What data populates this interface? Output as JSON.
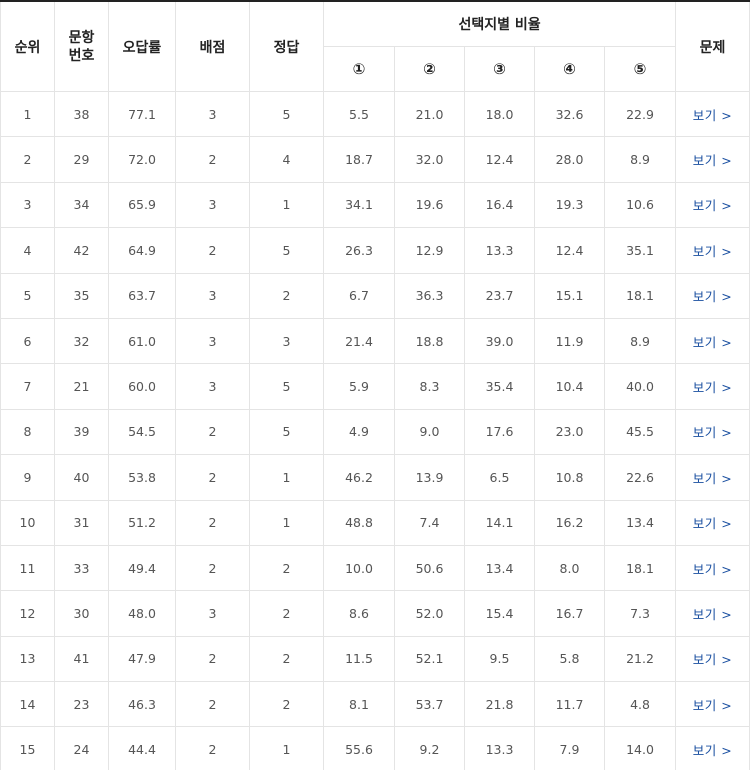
{
  "table": {
    "headers": {
      "rank": "순위",
      "question_no_line1": "문항",
      "question_no_line2": "번호",
      "error_rate": "오답률",
      "points": "배점",
      "answer": "정답",
      "choice_ratio": "선택지별 비율",
      "problem": "문제",
      "choices": [
        "①",
        "②",
        "③",
        "④",
        "⑤"
      ]
    },
    "view_label": "보기 >",
    "rows": [
      {
        "rank": "1",
        "no": "38",
        "rate": "77.1",
        "points": "3",
        "answer": "5",
        "c1": "5.5",
        "c2": "21.0",
        "c3": "18.0",
        "c4": "32.6",
        "c5": "22.9"
      },
      {
        "rank": "2",
        "no": "29",
        "rate": "72.0",
        "points": "2",
        "answer": "4",
        "c1": "18.7",
        "c2": "32.0",
        "c3": "12.4",
        "c4": "28.0",
        "c5": "8.9"
      },
      {
        "rank": "3",
        "no": "34",
        "rate": "65.9",
        "points": "3",
        "answer": "1",
        "c1": "34.1",
        "c2": "19.6",
        "c3": "16.4",
        "c4": "19.3",
        "c5": "10.6"
      },
      {
        "rank": "4",
        "no": "42",
        "rate": "64.9",
        "points": "2",
        "answer": "5",
        "c1": "26.3",
        "c2": "12.9",
        "c3": "13.3",
        "c4": "12.4",
        "c5": "35.1"
      },
      {
        "rank": "5",
        "no": "35",
        "rate": "63.7",
        "points": "3",
        "answer": "2",
        "c1": "6.7",
        "c2": "36.3",
        "c3": "23.7",
        "c4": "15.1",
        "c5": "18.1"
      },
      {
        "rank": "6",
        "no": "32",
        "rate": "61.0",
        "points": "3",
        "answer": "3",
        "c1": "21.4",
        "c2": "18.8",
        "c3": "39.0",
        "c4": "11.9",
        "c5": "8.9"
      },
      {
        "rank": "7",
        "no": "21",
        "rate": "60.0",
        "points": "3",
        "answer": "5",
        "c1": "5.9",
        "c2": "8.3",
        "c3": "35.4",
        "c4": "10.4",
        "c5": "40.0"
      },
      {
        "rank": "8",
        "no": "39",
        "rate": "54.5",
        "points": "2",
        "answer": "5",
        "c1": "4.9",
        "c2": "9.0",
        "c3": "17.6",
        "c4": "23.0",
        "c5": "45.5"
      },
      {
        "rank": "9",
        "no": "40",
        "rate": "53.8",
        "points": "2",
        "answer": "1",
        "c1": "46.2",
        "c2": "13.9",
        "c3": "6.5",
        "c4": "10.8",
        "c5": "22.6"
      },
      {
        "rank": "10",
        "no": "31",
        "rate": "51.2",
        "points": "2",
        "answer": "1",
        "c1": "48.8",
        "c2": "7.4",
        "c3": "14.1",
        "c4": "16.2",
        "c5": "13.4"
      },
      {
        "rank": "11",
        "no": "33",
        "rate": "49.4",
        "points": "2",
        "answer": "2",
        "c1": "10.0",
        "c2": "50.6",
        "c3": "13.4",
        "c4": "8.0",
        "c5": "18.1"
      },
      {
        "rank": "12",
        "no": "30",
        "rate": "48.0",
        "points": "3",
        "answer": "2",
        "c1": "8.6",
        "c2": "52.0",
        "c3": "15.4",
        "c4": "16.7",
        "c5": "7.3"
      },
      {
        "rank": "13",
        "no": "41",
        "rate": "47.9",
        "points": "2",
        "answer": "2",
        "c1": "11.5",
        "c2": "52.1",
        "c3": "9.5",
        "c4": "5.8",
        "c5": "21.2"
      },
      {
        "rank": "14",
        "no": "23",
        "rate": "46.3",
        "points": "2",
        "answer": "2",
        "c1": "8.1",
        "c2": "53.7",
        "c3": "21.8",
        "c4": "11.7",
        "c5": "4.8"
      },
      {
        "rank": "15",
        "no": "24",
        "rate": "44.4",
        "points": "2",
        "answer": "1",
        "c1": "55.6",
        "c2": "9.2",
        "c3": "13.3",
        "c4": "7.9",
        "c5": "14.0"
      }
    ]
  }
}
